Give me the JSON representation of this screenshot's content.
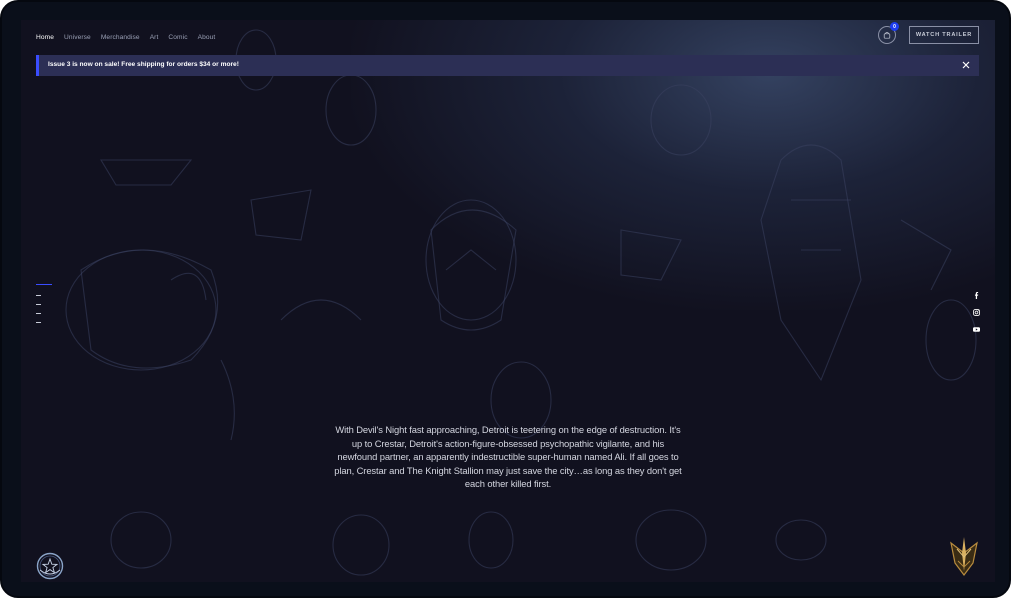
{
  "nav": {
    "items": [
      {
        "label": "Home",
        "active": true
      },
      {
        "label": "Universe",
        "active": false
      },
      {
        "label": "Merchandise",
        "active": false
      },
      {
        "label": "Art",
        "active": false
      },
      {
        "label": "Comic",
        "active": false
      },
      {
        "label": "About",
        "active": false
      }
    ]
  },
  "header": {
    "cart_count": "0",
    "cart_icon": "shopping-bag-icon",
    "trailer_label": "WATCH TRAILER"
  },
  "banner": {
    "text": "Issue 3 is now on sale! Free shipping for orders $34 or more!",
    "close_icon": "close-icon"
  },
  "slider": {
    "active_index": 0,
    "count": 5
  },
  "social": [
    {
      "icon": "facebook-icon"
    },
    {
      "icon": "instagram-icon"
    },
    {
      "icon": "youtube-icon"
    }
  ],
  "story": {
    "text": "With Devil's Night fast approaching, Detroit is teetering on the edge of destruction. It's up to Crestar, Detroit's action-figure-obsessed psychopathic vigilante, and his newfound partner, an apparently indestructible super-human named Ali. If all goes to plan, Crestar and The Knight Stallion may just save the city…as long as they don't get each other killed first."
  },
  "colors": {
    "accent": "#3a4dff",
    "background": "#11111f",
    "banner": "#2c2f55",
    "logo_gold": "#b98c3e"
  }
}
